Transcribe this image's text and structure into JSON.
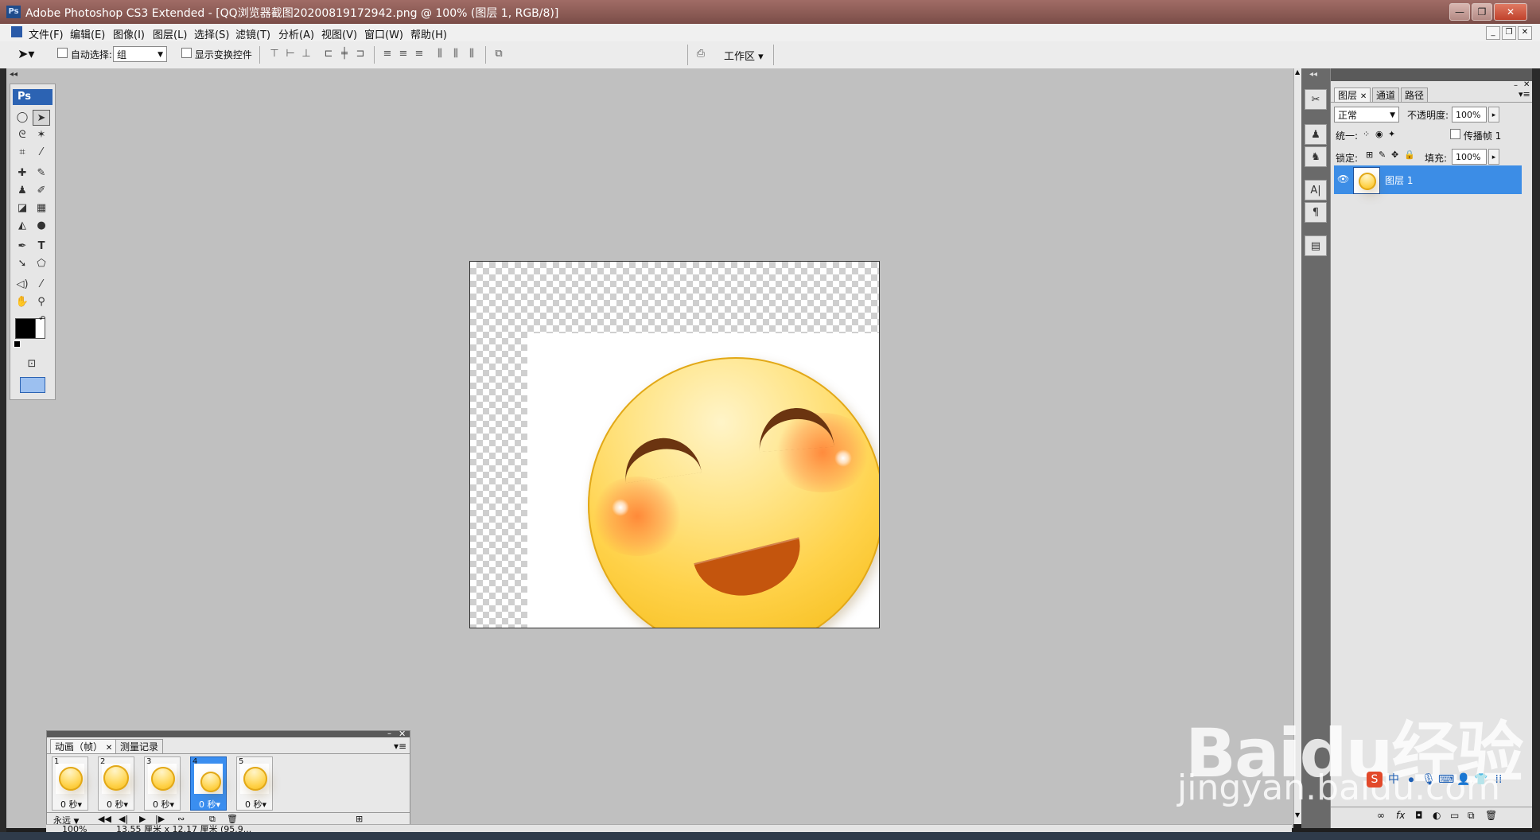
{
  "window": {
    "title": "Adobe Photoshop CS3 Extended - [QQ浏览器截图20200819172942.png @ 100% (图层 1, RGB/8)]",
    "ps_badge": "Ps",
    "controls": {
      "minimize": "—",
      "restore": "❐",
      "close": "✕"
    }
  },
  "menu": {
    "items": [
      "文件(F)",
      "编辑(E)",
      "图像(I)",
      "图层(L)",
      "选择(S)",
      "滤镜(T)",
      "分析(A)",
      "视图(V)",
      "窗口(W)",
      "帮助(H)"
    ],
    "doc_controls": {
      "minimize": "_",
      "restore": "❐",
      "close": "✕"
    }
  },
  "options": {
    "auto_select_label": "自动选择:",
    "auto_select_value": "组",
    "show_transform_label": "显示变换控件",
    "workspace_label": "工作区 ▾"
  },
  "toolbox": {
    "header": "Ps"
  },
  "animation": {
    "tabs": [
      "动画（帧）",
      "测量记录"
    ],
    "frames": [
      {
        "num": "1",
        "delay": "0 秒▾"
      },
      {
        "num": "2",
        "delay": "0 秒▾"
      },
      {
        "num": "3",
        "delay": "0 秒▾"
      },
      {
        "num": "4",
        "delay": "0 秒▾"
      },
      {
        "num": "5",
        "delay": "0 秒▾"
      }
    ],
    "loop": "永远"
  },
  "status": {
    "zoom": "100%",
    "doc_size": "13.55 厘米 x 12.17 厘米 (95.9..."
  },
  "layers": {
    "tabs": [
      "图层",
      "通道",
      "路径"
    ],
    "blend_mode": "正常",
    "opacity_label": "不透明度:",
    "opacity_value": "100%",
    "unify_label": "统一:",
    "propagate_label": "传播帧 1",
    "lock_label": "锁定:",
    "fill_label": "填充:",
    "fill_value": "100%",
    "layer_name": "图层 1"
  },
  "watermark": {
    "brand": "Baidu经验",
    "url": "jingyan.baidu.com"
  },
  "colors": {
    "accent": "#3c8de6",
    "workspace": "#c0c0c0",
    "title_bar": "#8a5a54"
  }
}
